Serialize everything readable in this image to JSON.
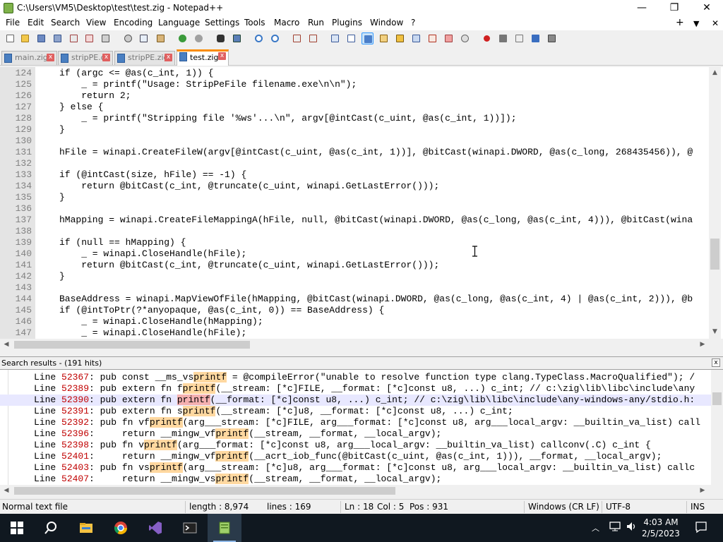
{
  "window": {
    "title": "C:\\Users\\VM5\\Desktop\\test\\test.zig - Notepad++",
    "minimize_icon": "—",
    "maximize_icon": "❐",
    "close_icon": "✕"
  },
  "menu": {
    "items": [
      "File",
      "Edit",
      "Search",
      "View",
      "Encoding",
      "Language",
      "Settings",
      "Tools",
      "Macro",
      "Run",
      "Plugins",
      "Window",
      "?"
    ],
    "right": [
      "+",
      "▼",
      "✕"
    ]
  },
  "tabs": [
    {
      "label": "main.zig",
      "active": false
    },
    {
      "label": "stripPE.c",
      "active": false
    },
    {
      "label": "stripPE.zig",
      "active": false
    },
    {
      "label": "test.zig",
      "active": true
    }
  ],
  "editor": {
    "lines": [
      {
        "n": "124",
        "code": "if (argc <= @as(c_int, 1)) {"
      },
      {
        "n": "125",
        "code": "    _ = printf(\"Usage: StripPeFile filename.exe\\n\\n\");"
      },
      {
        "n": "126",
        "code": "    return 2;"
      },
      {
        "n": "127",
        "code": "} else {"
      },
      {
        "n": "128",
        "code": "    _ = printf(\"Stripping file '%ws'...\\n\", argv[@intCast(c_uint, @as(c_int, 1))]);"
      },
      {
        "n": "129",
        "code": "}"
      },
      {
        "n": "130",
        "code": ""
      },
      {
        "n": "131",
        "code": "hFile = winapi.CreateFileW(argv[@intCast(c_uint, @as(c_int, 1))], @bitCast(winapi.DWORD, @as(c_long, 268435456)), @"
      },
      {
        "n": "132",
        "code": ""
      },
      {
        "n": "133",
        "code": "if (@intCast(size, hFile) == -1) {"
      },
      {
        "n": "134",
        "code": "    return @bitCast(c_int, @truncate(c_uint, winapi.GetLastError()));"
      },
      {
        "n": "135",
        "code": "}"
      },
      {
        "n": "136",
        "code": ""
      },
      {
        "n": "137",
        "code": "hMapping = winapi.CreateFileMappingA(hFile, null, @bitCast(winapi.DWORD, @as(c_long, @as(c_int, 4))), @bitCast(wina"
      },
      {
        "n": "138",
        "code": ""
      },
      {
        "n": "139",
        "code": "if (null == hMapping) {"
      },
      {
        "n": "140",
        "code": "    _ = winapi.CloseHandle(hFile);"
      },
      {
        "n": "141",
        "code": "    return @bitCast(c_int, @truncate(c_uint, winapi.GetLastError()));"
      },
      {
        "n": "142",
        "code": "}"
      },
      {
        "n": "143",
        "code": ""
      },
      {
        "n": "144",
        "code": "BaseAddress = winapi.MapViewOfFile(hMapping, @bitCast(winapi.DWORD, @as(c_long, @as(c_int, 4) | @as(c_int, 2))), @b"
      },
      {
        "n": "145",
        "code": "if (@intToPtr(?*anyopaque, @as(c_int, 0)) == BaseAddress) {"
      },
      {
        "n": "146",
        "code": "    _ = winapi.CloseHandle(hMapping);"
      },
      {
        "n": "147",
        "code": "    _ = winapi.CloseHandle(hFile);"
      }
    ]
  },
  "search_results": {
    "title": "Search results - (191 hits)",
    "close": "x",
    "lines": [
      {
        "label": "Line ",
        "num": "52367",
        "pre": ": pub const __ms_vs",
        "match": "printf",
        "post": " = @compileError(\"unable to resolve function type clang.TypeClass.MacroQualified\"); /",
        "selected": false
      },
      {
        "label": "Line ",
        "num": "52389",
        "pre": ": pub extern fn f",
        "match": "printf",
        "post": "(__stream: [*c]FILE, __format: [*c]const u8, ...) c_int; // c:\\zig\\lib\\libc\\include\\any",
        "selected": false
      },
      {
        "label": "Line ",
        "num": "52390",
        "pre": ": pub extern fn ",
        "match": "printf",
        "post": "(__format: [*c]const u8, ...) c_int; // c:\\zig\\lib\\libc\\include\\any-windows-any/stdio.h:",
        "selected": true
      },
      {
        "label": "Line ",
        "num": "52391",
        "pre": ": pub extern fn s",
        "match": "printf",
        "post": "(__stream: [*c]u8, __format: [*c]const u8, ...) c_int;",
        "selected": false
      },
      {
        "label": "Line ",
        "num": "52392",
        "pre": ": pub fn vf",
        "match": "printf",
        "post": "(arg___stream: [*c]FILE, arg___format: [*c]const u8, arg___local_argv: __builtin_va_list) call",
        "selected": false
      },
      {
        "label": "Line ",
        "num": "52396",
        "pre": ":     return __mingw_vf",
        "match": "printf",
        "post": "(__stream, __format, __local_argv);",
        "selected": false
      },
      {
        "label": "Line ",
        "num": "52398",
        "pre": ": pub fn v",
        "match": "printf",
        "post": "(arg___format: [*c]const u8, arg___local_argv: __builtin_va_list) callconv(.C) c_int {",
        "selected": false
      },
      {
        "label": "Line ",
        "num": "52401",
        "pre": ":     return __mingw_vf",
        "match": "printf",
        "post": "(__acrt_iob_func(@bitCast(c_uint, @as(c_int, 1))), __format, __local_argv);",
        "selected": false
      },
      {
        "label": "Line ",
        "num": "52403",
        "pre": ": pub fn vs",
        "match": "printf",
        "post": "(arg___stream: [*c]u8, arg___format: [*c]const u8, arg___local_argv: __builtin_va_list) callc",
        "selected": false
      },
      {
        "label": "Line ",
        "num": "52407",
        "pre": ":     return __mingw_vs",
        "match": "printf",
        "post": "(__stream, __format, __local_argv);",
        "selected": false
      }
    ]
  },
  "status": {
    "file_type": "Normal text file",
    "length": "length : 8,974",
    "lines": "lines : 169",
    "ln": "Ln : 18",
    "col": "Col : 5",
    "pos": "Pos : 931",
    "eol": "Windows (CR LF)",
    "encoding": "UTF-8",
    "mode": "INS"
  },
  "taskbar": {
    "time": "4:03 AM",
    "date": "2/5/2023",
    "colors": {
      "background": "#101820",
      "accent": "#8fb8e8"
    },
    "icons": [
      "windows-start-icon",
      "search-icon",
      "file-explorer-icon",
      "chrome-icon",
      "visual-studio-icon",
      "terminal-icon",
      "notepadpp-icon"
    ]
  },
  "colors": {
    "tab_active_accent": "#fa8c00",
    "match_highlight": "#ffd8a0",
    "line_number": "#808080",
    "result_line_number": "#c00000"
  }
}
